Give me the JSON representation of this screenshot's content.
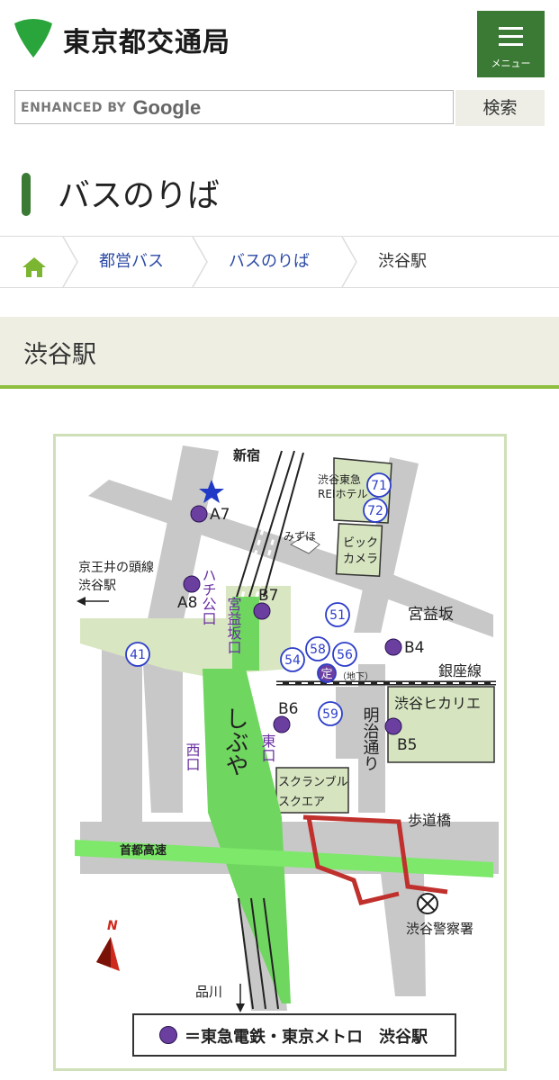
{
  "header": {
    "site_name": "東京都交通局",
    "menu_label": "メニュー"
  },
  "search": {
    "enhanced_by": "ENHANCED BY",
    "brand": "Google",
    "button": "検索"
  },
  "page_title": "バスのりば",
  "breadcrumb": [
    {
      "label": "ホーム",
      "icon": "home-icon"
    },
    {
      "label": "都営バス"
    },
    {
      "label": "バスのりば"
    },
    {
      "label": "渋谷駅"
    }
  ],
  "section_heading": "渋谷駅",
  "map": {
    "labels": {
      "shinjuku": "新宿",
      "tokyu_rei": "渋谷東急",
      "rei_hotel": "REIホテル",
      "mizuho": "みずほ",
      "bic1": "ビック",
      "bic2": "カメラ",
      "keio1": "京王井の頭線",
      "keio2": "渋谷駅",
      "hachiko": "ハチ公口",
      "miyamasuzaka_exit": "宮益坂口",
      "miyamasuzaka": "宮益坂",
      "ginza": "銀座線",
      "chika": "（地下）",
      "hikarie": "渋谷ヒカリエ",
      "meiji": "明治通り",
      "shibuya": "しぶや",
      "nishiguchi": "西口",
      "higashiguchi": "東口",
      "scramble1": "スクランブル",
      "scramble2": "スクエア",
      "hodokyo": "歩道橋",
      "shuto": "首都高速",
      "police": "渋谷警察署",
      "shinagawa": "品川",
      "north": "N"
    },
    "exits": [
      "A7",
      "A8",
      "B7",
      "B4",
      "B6",
      "B5"
    ],
    "stops": [
      "71",
      "72",
      "51",
      "41",
      "54",
      "58",
      "56",
      "定",
      "59"
    ],
    "legend": "＝東急電鉄・東京メトロ　渋谷駅",
    "colors": {
      "road": "#c8c8c8",
      "station": "#6fd65f",
      "plaza": "#d9e6c2",
      "building": "#d6e4c0",
      "expressway": "#7de86a",
      "footbridge": "#c0302c",
      "exit_dot": "#6b3fa0",
      "stop_ring": "#2d3ec9",
      "label_purple": "#6a2fa0"
    }
  }
}
